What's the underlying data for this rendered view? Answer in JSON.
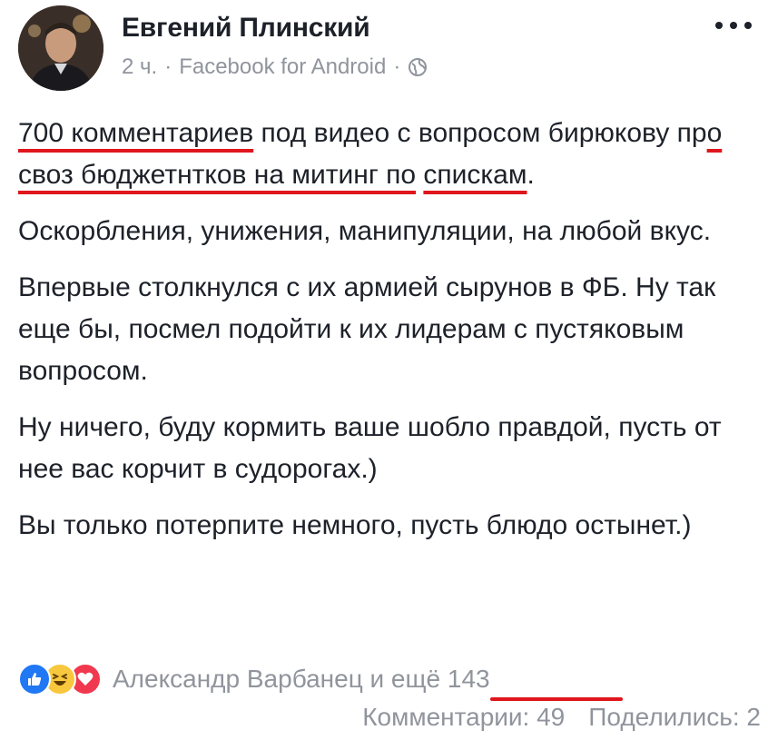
{
  "post": {
    "author": "Евгений Плинский",
    "time": "2 ч.",
    "separator": "·",
    "source": "Facebook for Android",
    "privacy_icon": "globe-icon",
    "more_icon": "more-horizontal-icon"
  },
  "content": {
    "p1_a": "700 комментариев",
    "p1_b": " под видео с вопросом бирюкову пр",
    "p1_c": "о своз бюджетнтков на митинг по",
    "p1_d": " ",
    "p1_e": "спискам",
    "p1_f": ".",
    "p2": "Оскорбления, унижения, манипуляции, на любой вкус.",
    "p3": "Впервые столкнулся с их армией сырунов в ФБ. Ну так еще бы, посмел подойти к их лидерам с пустяковым вопросом.",
    "p4": "Ну ничего, буду кормить ваше шобло правдой, пусть от нее вас корчит в судорогах.)",
    "p5": "Вы только потерпите немного, пусть блюдо остынет.)"
  },
  "footer": {
    "reactions": [
      "like-icon",
      "haha-icon",
      "love-icon"
    ],
    "reactors_text": "Александр Варбанец и ещё 143",
    "comments": "Комментарии: 49",
    "shares": "Поделились: 2"
  },
  "colors": {
    "text": "#1d2129",
    "meta": "#90949c",
    "annotation_red": "#e0161d",
    "like_blue": "#2078f4",
    "love_red": "#f0384e",
    "haha_yellow": "#f7c83e"
  }
}
